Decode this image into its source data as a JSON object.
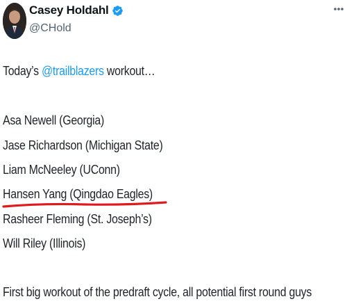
{
  "author": {
    "display_name": "Casey Holdahl",
    "handle": "@CHold",
    "verified_icon": "verified-badge-icon",
    "avatar": "profile-photo"
  },
  "tweet": {
    "intro_prefix": "Today’s ",
    "intro_mention": "@trailblazers",
    "intro_suffix": " workout…",
    "players": [
      "Asa Newell (Georgia)",
      "Jase Richardson (Michigan State)",
      "Liam McNeeley (UConn)",
      "Hansen Yang (Qingdao Eagles)",
      "Rasheer Fleming (St. Joseph’s)",
      "Will Riley (Illinois)"
    ],
    "highlighted_player_index": 3,
    "closing": "First big workout of the predraft cycle, all potential first round guys"
  },
  "colors": {
    "mention": "#1d9bf0",
    "verified": "#1d9bf0",
    "highlight_underline": "#e0191f",
    "handle": "#536471"
  }
}
